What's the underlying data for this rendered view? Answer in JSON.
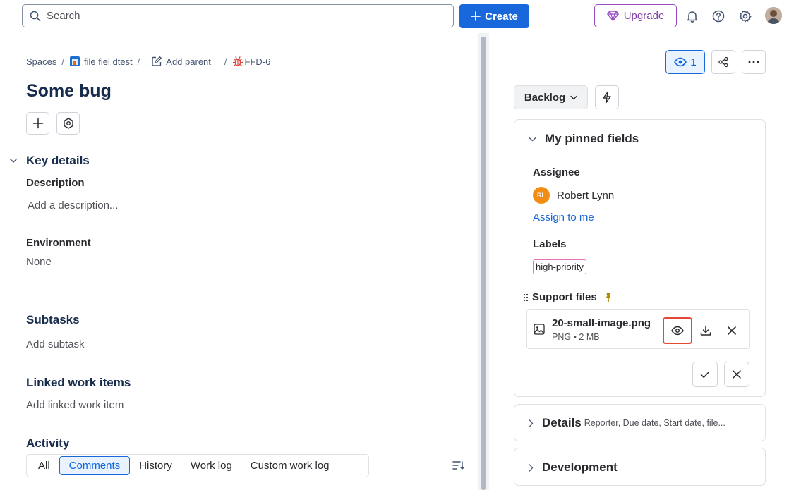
{
  "topbar": {
    "search_placeholder": "Search",
    "create_label": "Create",
    "upgrade_label": "Upgrade"
  },
  "breadcrumb": {
    "spaces": "Spaces",
    "project": "file fiel dtest",
    "add_parent": "Add parent",
    "issue_key": "FFD-6"
  },
  "issue": {
    "title": "Some bug"
  },
  "key_details": {
    "heading": "Key details",
    "description_label": "Description",
    "description_placeholder": "Add a description...",
    "environment_label": "Environment",
    "environment_value": "None"
  },
  "subtasks": {
    "heading": "Subtasks",
    "add": "Add subtask"
  },
  "linked": {
    "heading": "Linked work items",
    "add": "Add linked work item"
  },
  "activity": {
    "heading": "Activity",
    "tabs": [
      "All",
      "Comments",
      "History",
      "Work log",
      "Custom work log"
    ],
    "active_tab": "Comments"
  },
  "sidebar": {
    "watch_count": "1",
    "status": "Backlog",
    "pinned": {
      "heading": "My pinned fields",
      "assignee_label": "Assignee",
      "assignee_initials": "RL",
      "assignee_name": "Robert Lynn",
      "assign_to_me": "Assign to me",
      "labels_label": "Labels",
      "label_chip": "high-priority",
      "support_files_label": "Support files",
      "file_name": "20-small-image.png",
      "file_meta": "PNG • 2 MB"
    },
    "details": {
      "heading": "Details",
      "summary": "Reporter, Due date, Start date, file..."
    },
    "development": {
      "heading": "Development"
    }
  },
  "colors": {
    "primary": "#1868db",
    "upgrade": "#964ac0",
    "highlight": "#e34935",
    "label_border": "#e774bb",
    "avatar": "#f18d13"
  }
}
